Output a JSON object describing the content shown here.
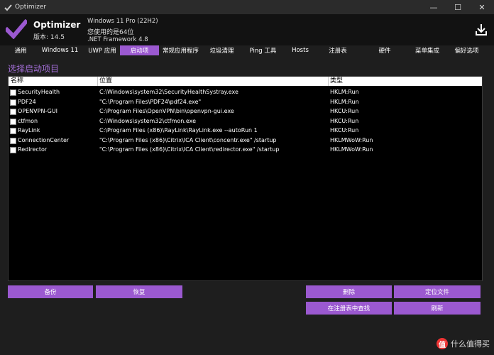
{
  "window": {
    "title": "Optimizer"
  },
  "window_controls": {
    "minimize": "—",
    "maximize": "☐",
    "close": "✕"
  },
  "header": {
    "app_name": "Optimizer",
    "version": "版本: 14.5",
    "os": "Windows 11 Pro (22H2)",
    "arch": "您使用的是64位",
    "framework": ".NET Framework 4.8"
  },
  "tabs": [
    {
      "label": "通用"
    },
    {
      "label": "Windows 11"
    },
    {
      "label": "UWP 应用"
    },
    {
      "label": "启动项"
    },
    {
      "label": "常规应用程序"
    },
    {
      "label": "垃圾清理"
    },
    {
      "label": "Ping 工具"
    },
    {
      "label": "Hosts"
    },
    {
      "label": "注册表"
    },
    {
      "label": "硬件"
    },
    {
      "label": "菜单集成"
    },
    {
      "label": "偏好选项"
    }
  ],
  "active_tab": "启动项",
  "section_title": "选择启动项目",
  "table": {
    "columns": [
      "名称",
      "位置",
      "类型"
    ],
    "rows": [
      {
        "name": "SecurityHealth",
        "location": "C:\\Windows\\system32\\SecurityHealthSystray.exe",
        "type": "HKLM:Run"
      },
      {
        "name": "PDF24",
        "location": "\"C:\\Program Files\\PDF24\\pdf24.exe\"",
        "type": "HKLM:Run"
      },
      {
        "name": "OPENVPN-GUI",
        "location": "C:\\Program Files\\OpenVPN\\bin\\openvpn-gui.exe",
        "type": "HKCU:Run"
      },
      {
        "name": "ctfmon",
        "location": "C:\\Windows\\system32\\ctfmon.exe",
        "type": "HKCU:Run"
      },
      {
        "name": "RayLink",
        "location": "C:\\Program Files (x86)\\RayLink\\RayLink.exe --autoRun 1",
        "type": "HKCU:Run"
      },
      {
        "name": "ConnectionCenter",
        "location": "\"C:\\Program Files (x86)\\Citrix\\ICA Client\\concentr.exe\" /startup",
        "type": "HKLMWoW:Run"
      },
      {
        "name": "Redirector",
        "location": "\"C:\\Program Files (x86)\\Citrix\\ICA Client\\redirector.exe\" /startup",
        "type": "HKLMWoW:Run"
      }
    ]
  },
  "buttons": {
    "backup": "备份",
    "restore": "恢复",
    "delete": "删除",
    "locate_file": "定位文件",
    "find_in_registry": "在注册表中查找",
    "refresh": "刷新"
  },
  "watermark": {
    "circle": "值",
    "text": "什么值得买"
  },
  "colors": {
    "accent": "#9b59d0",
    "title_text": "#a46fd8",
    "background": "#1e1e1e"
  },
  "icons": {
    "app": "check-logo-icon",
    "download": "download-icon"
  }
}
